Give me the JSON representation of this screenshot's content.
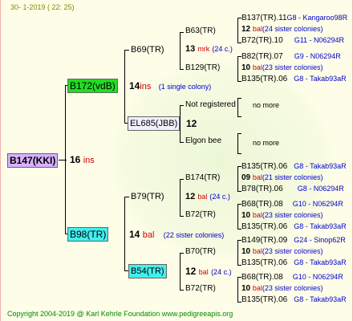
{
  "header": {
    "date": "30-   1-2019 (  22:  25)"
  },
  "footer": {
    "copyright": "Copyright 2004-2019 @ Karl Kehrle Foundation    www.pedigreeapis.org"
  },
  "colors": {
    "green_box": "#22dd22",
    "cyan_box": "#44eeee",
    "purple_box": "#d8b0ff",
    "link_blue": "#0000cc",
    "red_text": "#cc0000"
  },
  "root": {
    "name": "B147(KKI)",
    "gen": "16",
    "suffix": "ins"
  },
  "gen1": {
    "top": {
      "name": "B172(vdB)",
      "gen": "14",
      "suffix": "ins",
      "note": "(1 single colony)"
    },
    "bottom": {
      "name": "B98(TR)",
      "gen": "14",
      "suffix": "bal",
      "note": "(22 sister colonies)"
    }
  },
  "gen2": {
    "b69": {
      "name": "B69(TR)"
    },
    "el685": {
      "name": "EL685(JBB)",
      "gen": "12"
    },
    "b79": {
      "name": "B79(TR)"
    },
    "b54": {
      "name": "B54(TR)",
      "gen": "12",
      "suffix": "bal",
      "note": "(24 c.)"
    }
  },
  "gen3": {
    "b63": {
      "name": "B63(TR)",
      "gen": "13",
      "suffix": "mrk",
      "note": "(24 c.)"
    },
    "b129": {
      "name": "B129(TR)"
    },
    "notreg": {
      "name": "Not registered",
      "gen": "12"
    },
    "elgon": {
      "name": "Elgon bee"
    },
    "b174": {
      "name": "B174(TR)"
    },
    "b72a": {
      "name": "B72(TR)",
      "gen": "12",
      "suffix": "bal",
      "note": "(24 c.)"
    },
    "b70": {
      "name": "B70(TR)"
    },
    "b72b": {
      "name": "B72(TR)"
    }
  },
  "gen4": {
    "r1": {
      "name": "B137(TR).11",
      "code": "G8 - Kangaroo98R"
    },
    "r2": {
      "gen": "12",
      "suffix": "bal",
      "note": "(24 sister colonies)"
    },
    "r3": {
      "name": "B72(TR).10",
      "code": "G11 - N06294R"
    },
    "r4": {
      "name": "B82(TR).07",
      "code": "G9 - N06294R"
    },
    "r5": {
      "gen": "10",
      "suffix": "bal",
      "note": "(23 sister colonies)"
    },
    "r6": {
      "name": "B135(TR).06",
      "code": "G8 - Takab93aR"
    },
    "more1": "no more",
    "more2": "no more",
    "r7": {
      "name": "B135(TR).06",
      "code": "G8 - Takab93aR"
    },
    "r8": {
      "gen": "09",
      "suffix": "bal",
      "note": "(21 sister colonies)"
    },
    "r9": {
      "name": "B78(TR).06",
      "code": "G8 - N06294R"
    },
    "r10": {
      "name": "B68(TR).08",
      "code": "G10 - N06294R"
    },
    "r11": {
      "gen": "10",
      "suffix": "bal",
      "note": "(23 sister colonies)"
    },
    "r12": {
      "name": "B135(TR).06",
      "code": "G8 - Takab93aR"
    },
    "r13": {
      "name": "B149(TR).09",
      "code": "G24 - Sinop62R"
    },
    "r14": {
      "gen": "10",
      "suffix": "bal",
      "note": "(23 sister colonies)"
    },
    "r15": {
      "name": "B135(TR).06",
      "code": "G8 - Takab93aR"
    },
    "r16": {
      "name": "B68(TR).08",
      "code": "G10 - N06294R"
    },
    "r17": {
      "gen": "10",
      "suffix": "bal",
      "note": "(23 sister colonies)"
    },
    "r18": {
      "name": "B135(TR).06",
      "code": "G8 - Takab93aR"
    }
  }
}
